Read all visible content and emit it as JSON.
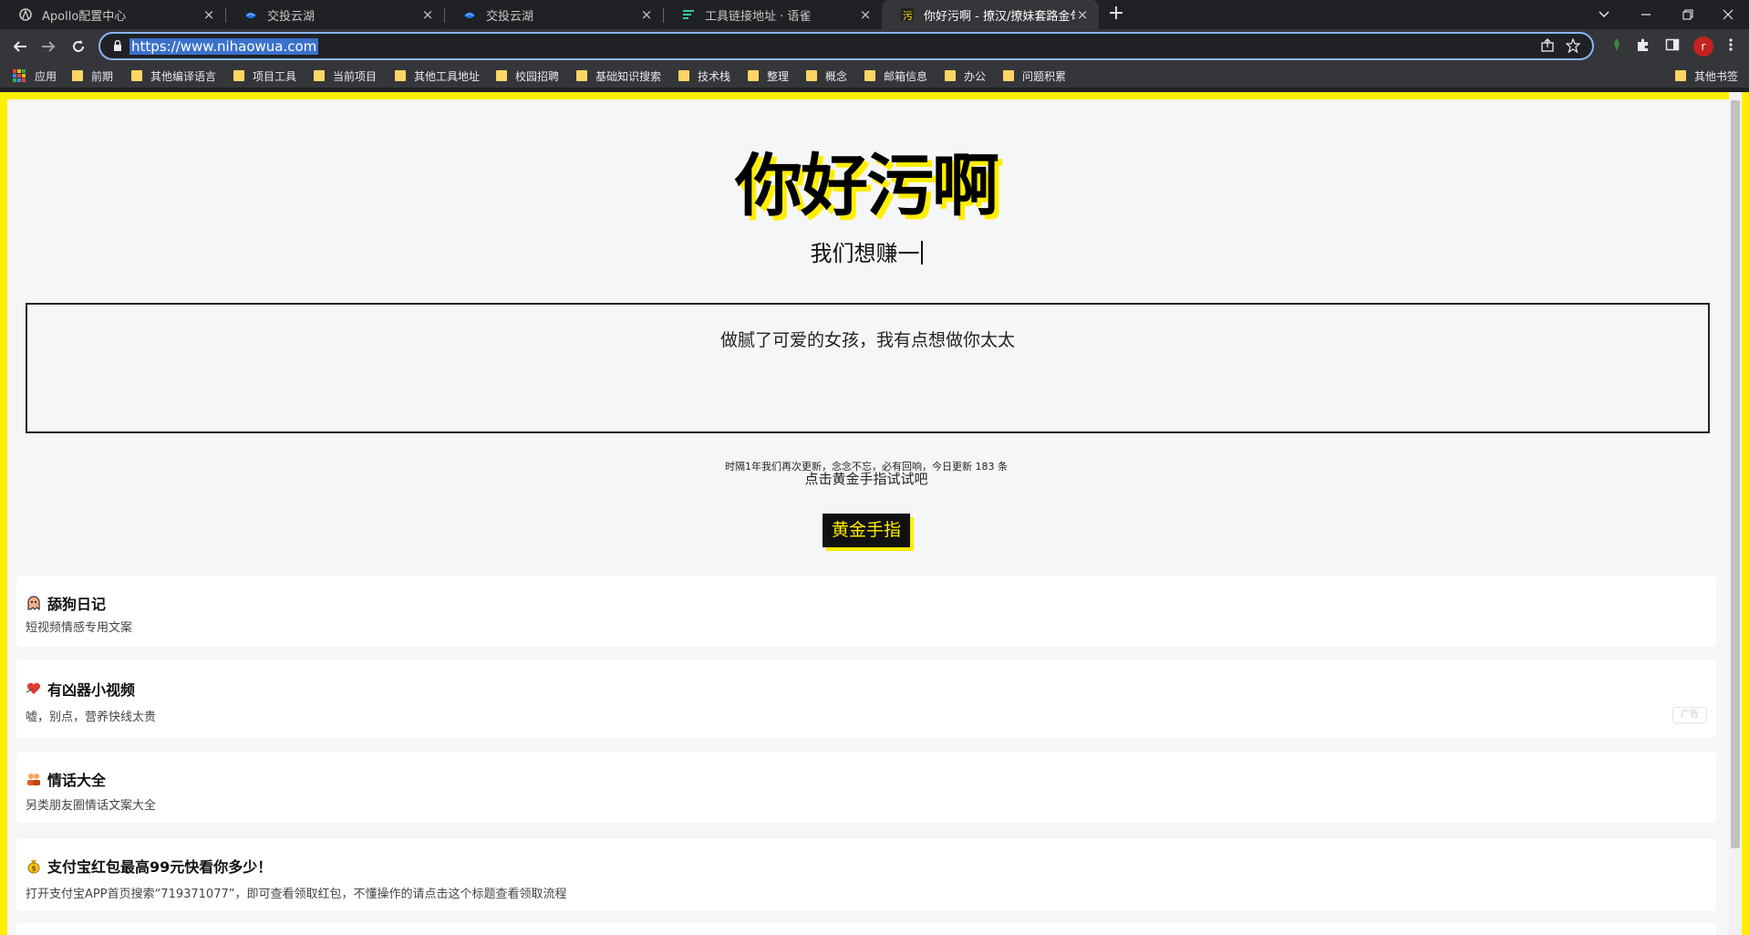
{
  "browser": {
    "tabs": [
      {
        "label": "Apollo配置中心",
        "icon": "apollo-icon"
      },
      {
        "label": "交投云湖",
        "icon": "cloud-lake-icon"
      },
      {
        "label": "交投云湖",
        "icon": "cloud-lake-icon"
      },
      {
        "label": "工具链接地址 · 语雀",
        "icon": "yuque-icon"
      },
      {
        "label": "你好污啊 - 撩汉/撩妹套路金句大",
        "icon": "site-favicon",
        "active": true
      }
    ],
    "close_glyph": "×",
    "new_tab_glyph": "+",
    "url": "https://www.nihaowua.com",
    "avatar_letter": "r",
    "bookmarks": [
      {
        "label": "应用",
        "type": "apps"
      },
      {
        "label": "前期",
        "type": "folder"
      },
      {
        "label": "其他编译语言",
        "type": "folder"
      },
      {
        "label": "项目工具",
        "type": "folder"
      },
      {
        "label": "当前项目",
        "type": "folder"
      },
      {
        "label": "其他工具地址",
        "type": "folder"
      },
      {
        "label": "校园招聘",
        "type": "folder"
      },
      {
        "label": "基础知识搜索",
        "type": "folder"
      },
      {
        "label": "技术栈",
        "type": "folder"
      },
      {
        "label": "整理",
        "type": "folder"
      },
      {
        "label": "概念",
        "type": "folder"
      },
      {
        "label": "邮箱信息",
        "type": "folder"
      },
      {
        "label": "办公",
        "type": "folder"
      },
      {
        "label": "问题积累",
        "type": "folder"
      }
    ],
    "other_bookmarks": "其他书签"
  },
  "page": {
    "title": "你好污啊",
    "subtitle": "我们想赚一",
    "quote": "做腻了可爱的女孩，我有点想做你太太",
    "update_note": "时隔1年我们再次更新，念念不忘，必有回响，今日更新 183 条",
    "try_text": "点击黄金手指试试吧",
    "gold_button": "黄金手指",
    "ad_label": "广告",
    "cards": [
      {
        "title": "舔狗日记",
        "desc": "短视频情感专用文案",
        "icon": "ghost-icon"
      },
      {
        "title": "有凶器小视频",
        "desc": "嘘，别点，营养快线太贵",
        "icon": "heart-icon"
      },
      {
        "title": "情话大全",
        "desc": "另类朋友圈情话文案大全",
        "icon": "couple-icon"
      },
      {
        "title": "支付宝红包最高99元快看你多少！",
        "desc": "打开支付宝APP首页搜索“719371077”，即可查看领取红包，不懂操作的请点击这个标题查看领取流程",
        "icon": "money-bag-icon"
      }
    ]
  },
  "colors": {
    "accent_yellow": "#ffee00",
    "chrome_dark": "#202124",
    "chrome_toolbar": "#35363a",
    "url_focus": "#8ab4f8"
  }
}
